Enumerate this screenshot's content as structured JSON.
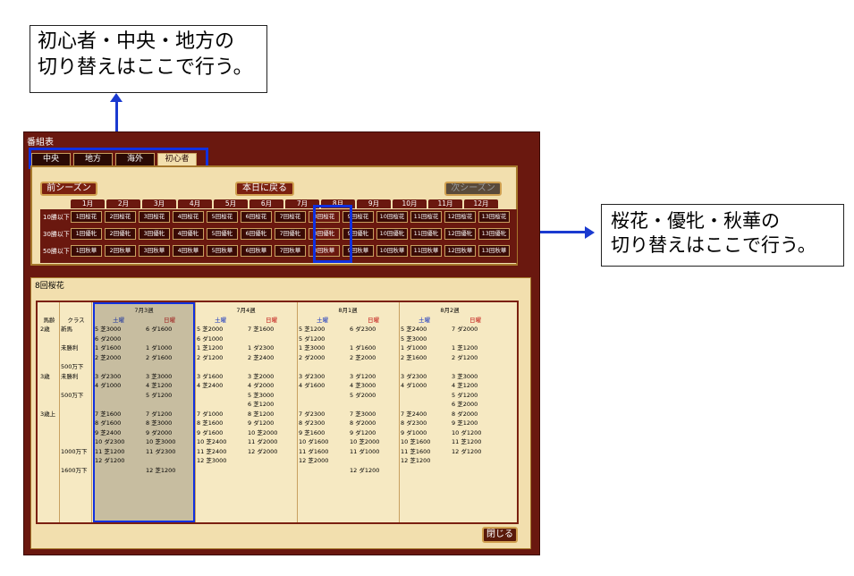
{
  "callouts": {
    "top": [
      "初心者・中央・地方の",
      "切り替えはここで行う。"
    ],
    "right": [
      "桜花・優牝・秋華の",
      "切り替えはここで行う。"
    ]
  },
  "window": {
    "title": "番組表",
    "tabs": [
      "中央",
      "地方",
      "海外",
      "初心者"
    ],
    "active_tab": "初心者",
    "prev_season": "前シーズン",
    "today": "本日に戻る",
    "next_season": "次シーズン",
    "months": [
      "1月",
      "2月",
      "3月",
      "4月",
      "5月",
      "6月",
      "7月",
      "8月",
      "9月",
      "10月",
      "11月",
      "12月"
    ],
    "row_labels": [
      "10勝以下",
      "30勝以下",
      "50勝以下"
    ],
    "race_rows": [
      [
        "1回桜花",
        "2回桜花",
        "3回桜花",
        "4回桜花",
        "5回桜花",
        "6回桜花",
        "7回桜花",
        "8回桜花",
        "9回桜花",
        "10回桜花",
        "11回桜花",
        "12回桜花",
        "13回桜花"
      ],
      [
        "1回優牝",
        "2回優牝",
        "3回優牝",
        "4回優牝",
        "5回優牝",
        "6回優牝",
        "7回優牝",
        "8回優牝",
        "9回優牝",
        "10回優牝",
        "11回優牝",
        "12回優牝",
        "13回優牝"
      ],
      [
        "1回秋華",
        "2回秋華",
        "3回秋華",
        "4回秋華",
        "5回秋華",
        "6回秋華",
        "7回秋華",
        "8回秋華",
        "9回秋華",
        "10回秋華",
        "11回秋華",
        "12回秋華",
        "13回秋華"
      ]
    ],
    "section_title": "8回桜花",
    "weeks": [
      "7月3週",
      "7月4週",
      "8月1週",
      "8月2週"
    ],
    "days": [
      "土曜",
      "日曜"
    ],
    "headers": {
      "age": "馬齢",
      "class": "クラス"
    },
    "ages": [
      "2歳",
      "3歳",
      "3歳上"
    ],
    "classes": [
      "新馬",
      "未勝利",
      "500万下",
      "未勝利",
      "500万下",
      "1000万下",
      "1600万下"
    ],
    "week1_sat": [
      "5 芝3000",
      "6 ダ2000",
      "1 ダ1600",
      "2 芝2000",
      "",
      "3 ダ2300",
      "4 ダ1000",
      "",
      "",
      "7 芝1600",
      "8 ダ1600",
      "9 芝2400",
      "10 ダ2300",
      "11 芝1200",
      "12 ダ1200",
      ""
    ],
    "week1_sun": [
      "6 ダ1600",
      "",
      "1 ダ1000",
      "2 ダ1600",
      "",
      "3 芝3000",
      "4 芝1200",
      "5 ダ1200",
      "",
      "7 ダ1200",
      "8 芝3000",
      "9 ダ2000",
      "10 芝3000",
      "11 ダ2300",
      "",
      "12 芝1200"
    ],
    "week2_sat": [
      "5 芝2000",
      "6 ダ1000",
      "1 芝1200",
      "2 ダ1200",
      "",
      "3 ダ1600",
      "4 芝2400",
      "",
      "",
      "7 ダ1000",
      "8 芝1600",
      "9 ダ1600",
      "10 芝2400",
      "11 芝2400",
      "12 芝3000",
      ""
    ],
    "week2_sun": [
      "7 芝1600",
      "",
      "1 ダ2300",
      "2 芝2400",
      "",
      "3 芝2000",
      "4 ダ2000",
      "5 芝3000",
      "6 芝1200",
      "8 芝1200",
      "9 ダ1200",
      "10 芝2000",
      "11 ダ2000",
      "12 ダ2000",
      "",
      ""
    ],
    "week3_sat": [
      "5 芝1200",
      "5 ダ1200",
      "1 芝3000",
      "2 ダ2000",
      "",
      "3 ダ2300",
      "4 ダ1600",
      "",
      "",
      "7 ダ2300",
      "8 ダ2300",
      "9 芝1600",
      "10 ダ1600",
      "11 ダ1600",
      "12 芝2000",
      ""
    ],
    "week3_sun": [
      "6 ダ2300",
      "",
      "1 ダ1600",
      "2 芝2000",
      "",
      "3 ダ1200",
      "4 芝3000",
      "5 ダ2000",
      "",
      "7 芝3000",
      "8 ダ2000",
      "9 ダ1200",
      "10 芝2000",
      "11 ダ1000",
      "",
      "12 ダ1200"
    ],
    "week4_sat": [
      "5 芝2400",
      "5 芝3000",
      "1 ダ1000",
      "2 芝1600",
      "",
      "3 ダ2300",
      "4 ダ1000",
      "",
      "",
      "7 芝2400",
      "8 ダ2300",
      "9 ダ1000",
      "10 芝1600",
      "11 芝1600",
      "12 芝1200",
      ""
    ],
    "week4_sun": [
      "7 ダ2000",
      "",
      "1 芝1200",
      "2 ダ1200",
      "",
      "3 芝3000",
      "4 芝1200",
      "5 ダ1200",
      "6 芝2000",
      "8 ダ2000",
      "9 芝1200",
      "10 ダ1200",
      "11 芝1200",
      "12 ダ1200",
      "",
      ""
    ],
    "close": "閉じる"
  }
}
